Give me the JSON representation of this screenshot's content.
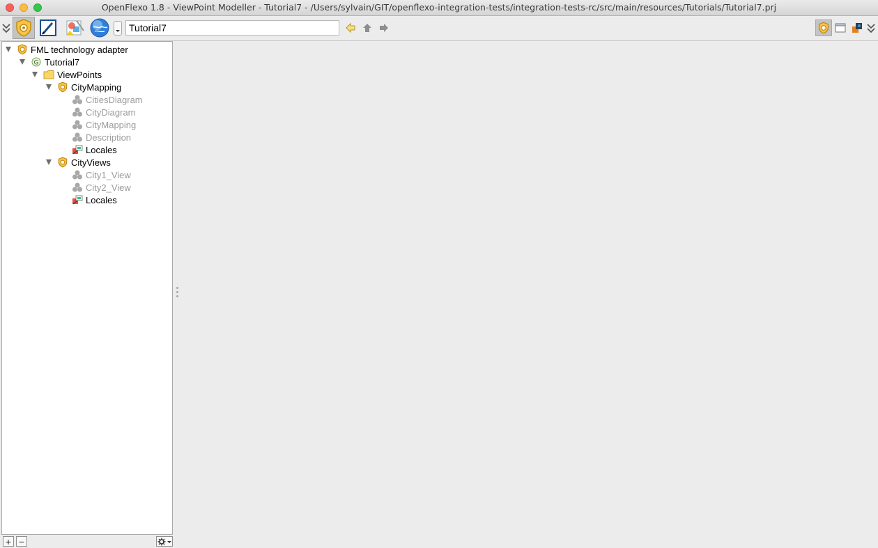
{
  "window": {
    "title": "OpenFlexo 1.8 - ViewPoint Modeller - Tutorial7 - /Users/sylvain/GIT/openflexo-integration-tests/integration-tests-rc/src/main/resources/Tutorials/Tutorial7.prj"
  },
  "toolbar": {
    "modules": [
      {
        "icon": "viewpoint-modeller-icon",
        "active": true
      },
      {
        "icon": "pen-editor-icon",
        "active": false
      },
      {
        "icon": "diagram-editor-icon",
        "active": false
      },
      {
        "icon": "globe-icon",
        "active": false
      }
    ],
    "search_value": "Tutorial7",
    "nav": [
      "back-arrow-icon",
      "up-arrow-icon",
      "forward-arrow-icon"
    ],
    "right_buttons": [
      {
        "icon": "viewpoint-perspective-icon",
        "active": true
      },
      {
        "icon": "window-icon",
        "active": false
      },
      {
        "icon": "locales-perspective-icon",
        "active": false
      }
    ]
  },
  "tree": {
    "root": "FML technology adapter",
    "project": "Tutorial7",
    "folder": "ViewPoints",
    "viewpoints": [
      {
        "label": "CityMapping",
        "children": [
          {
            "label": "CitiesDiagram",
            "greyed": true
          },
          {
            "label": "CityDiagram",
            "greyed": true
          },
          {
            "label": "CityMapping",
            "greyed": true
          },
          {
            "label": "Description",
            "greyed": true
          },
          {
            "label": "Locales",
            "greyed": false
          }
        ]
      },
      {
        "label": "CityViews",
        "children": [
          {
            "label": "City1_View",
            "greyed": true
          },
          {
            "label": "City2_View",
            "greyed": true
          },
          {
            "label": "Locales",
            "greyed": false
          }
        ]
      }
    ]
  },
  "bottom_bar": {
    "add_label": "+",
    "remove_label": "−"
  }
}
